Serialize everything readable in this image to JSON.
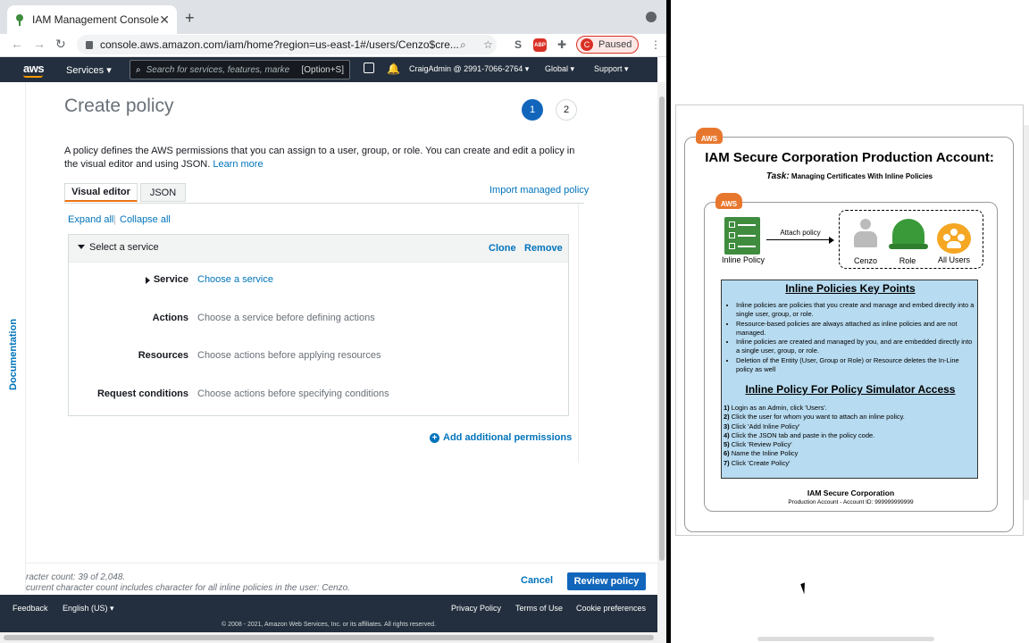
{
  "browser": {
    "tab_title": "IAM Management Console",
    "url": "console.aws.amazon.com/iam/home?region=us-east-1#/users/Cenzo$cre...",
    "profile_initial": "C",
    "profile_status": "Paused",
    "abp_label": "ABP"
  },
  "aws_nav": {
    "logo": "aws",
    "services": "Services",
    "search_placeholder": "Search for services, features, marke",
    "search_shortcut": "[Option+S]",
    "account": "CraigAdmin @ 2991-7066-2764",
    "region": "Global",
    "support": "Support"
  },
  "sidebar": {
    "documentation": "Documentation"
  },
  "page": {
    "title": "Create policy",
    "steps": [
      "1",
      "2"
    ],
    "description": "A policy defines the AWS permissions that you can assign to a user, group, or role. You can create and edit a policy in the visual editor and using JSON.",
    "learn_more": "Learn more",
    "tabs": {
      "visual": "Visual editor",
      "json": "JSON"
    },
    "import_link": "Import managed policy",
    "expand_all": "Expand all",
    "separator": "|",
    "collapse_all": "Collapse all"
  },
  "service_panel": {
    "title": "Select a service",
    "clone": "Clone",
    "remove": "Remove",
    "rows": [
      {
        "label": "Service",
        "value": "Choose a service"
      },
      {
        "label": "Actions",
        "value": "Choose a service before defining actions"
      },
      {
        "label": "Resources",
        "value": "Choose actions before applying resources"
      },
      {
        "label": "Request conditions",
        "value": "Choose actions before specifying conditions"
      }
    ],
    "add_permissions": "Add additional permissions"
  },
  "form_footer": {
    "char_count": "racter count: 39 of 2,048.",
    "char_note": "current character count includes character for all inline policies in the user: Cenzo.",
    "cancel": "Cancel",
    "review": "Review policy"
  },
  "aws_footer": {
    "feedback": "Feedback",
    "language": "English (US)",
    "privacy": "Privacy Policy",
    "terms": "Terms of Use",
    "cookies": "Cookie preferences",
    "copyright": "© 2008 - 2021, Amazon Web Services, Inc. or its affiliates. All rights reserved."
  },
  "slide": {
    "aws_badge": "AWS",
    "title": "IAM Secure Corporation Production Account:",
    "task_label": "Task:",
    "task_text": "Managing Certificates With Inline Policies",
    "inline_policy_label": "Inline Policy",
    "attach_label": "Attach policy",
    "entity_labels": [
      "Cenzo",
      "Role",
      "All Users"
    ],
    "key_points_title": "Inline Policies Key Points",
    "key_points": [
      "Inline policies are policies that you create and manage and embed directly into a single user, group, or role.",
      "Resource-based policies are always attached as inline policies and are not managed.",
      "Inline policies are created and managed by you, and are embedded directly into a single user, group, or role.",
      "Deletion of the Entity (User, Group or Role) or Resource deletes the In-Line policy as well"
    ],
    "simulator_title": "Inline Policy For Policy Simulator Access",
    "simulator_steps": [
      {
        "num": "1)",
        "text": "Login as an Admin, click 'Users'."
      },
      {
        "num": "2)",
        "text": "Click the user for whom you want to attach an inline policy."
      },
      {
        "num": "3)",
        "text": "Click 'Add Inline Policy'"
      },
      {
        "num": "4)",
        "text": "Click the JSON tab and paste in the policy code."
      },
      {
        "num": "5)",
        "text": "Click 'Review Policy'"
      },
      {
        "num": "6)",
        "text": "Name the Inline Policy"
      },
      {
        "num": "7)",
        "text": "Click 'Create Policy'"
      }
    ],
    "corp_name": "IAM Secure Corporation",
    "corp_account": "Production Account - Account ID: 999999999999"
  },
  "icons": {
    "back": "←",
    "forward": "→",
    "reload": "↻",
    "star": "☆",
    "puzzle": "✚",
    "menu": "⋮",
    "search": "⌕",
    "close": "✕",
    "newtab": "+",
    "caret": "▾"
  }
}
